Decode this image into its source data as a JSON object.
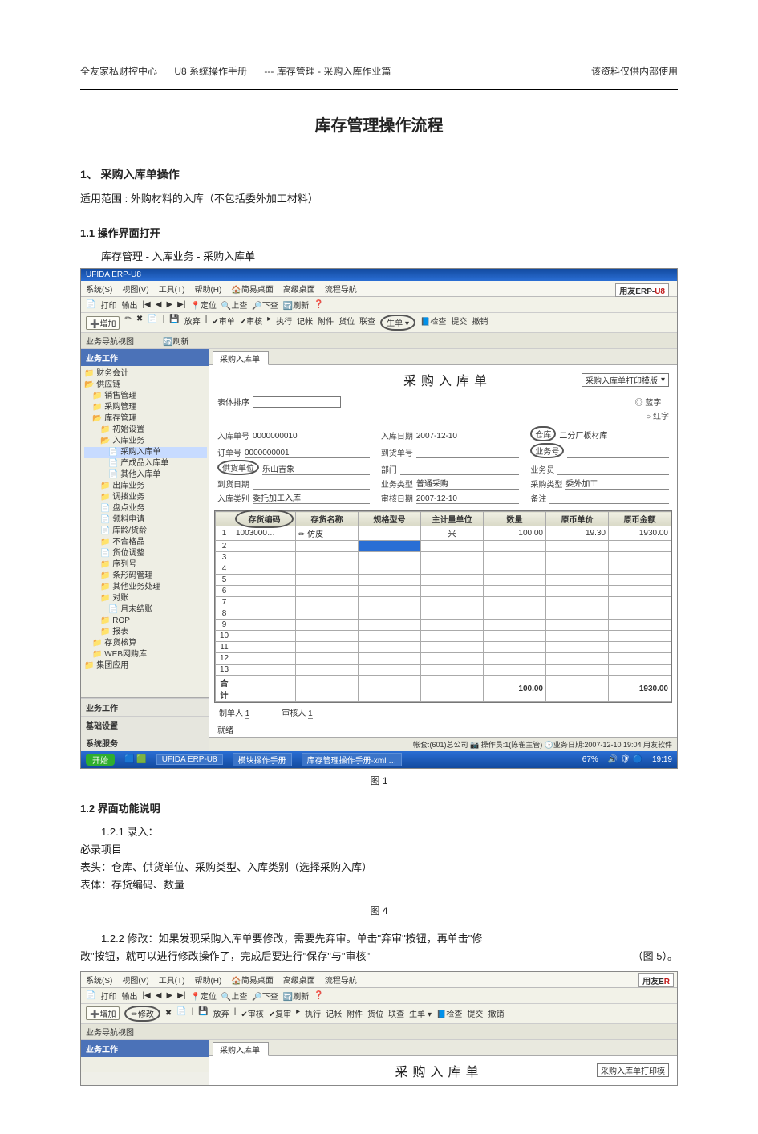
{
  "header": {
    "org": "全友家私财控中心",
    "manual": "U8  系统操作手册",
    "crumb": "--- 库存管理  - 采购入库作业篇",
    "note": "该资料仅供内部使用"
  },
  "doc": {
    "title": "库存管理操作流程",
    "s1": "1、 采购入库单操作",
    "s1_scope_label": "适用范围    :",
    "s1_scope": "外购材料的入库（不包括委外加工材料）",
    "s1_1": "1.1 操作界面打开",
    "s1_1_path": "库存管理 - 入库业务 - 采购入库单",
    "fig1": "图  1",
    "s1_2": "1.2  界面功能说明",
    "s1_2_1": "1.2.1 录入：",
    "must": "必录项目",
    "must_head": "表头：仓库、供货单位、采购类型、入库类别（选择采购入库）",
    "must_body": "表体：存货编码、数量",
    "fig4": "图  4",
    "s1_2_2a": "1.2.2 修改：如果发现采购入库单要修改，需要先弃审。单击\"弃审\"按钮，再单击\"修",
    "s1_2_2b": "改\"按钮，就可以进行修改操作了，完成后要进行\"保存\"与\"审核\"",
    "s1_2_2c": "（图  5）。"
  },
  "shot": {
    "titlebar": "UFIDA ERP-U8",
    "menu": [
      "系统(S)",
      "视图(V)",
      "工具(T)",
      "帮助(H)",
      "🏠简易桌面",
      "高级桌面",
      "流程导航"
    ],
    "brand_a": "用友ERP-",
    "brand_b": "U8",
    "tool1": [
      "📄",
      "打印",
      "输出",
      "|◀",
      "◀",
      "▶",
      "▶|",
      "📍定位",
      "🔍上查",
      "🔎下查",
      "🔄刷新",
      "❓"
    ],
    "tool2_add": "➕增加",
    "tool2": [
      "✏",
      "✖",
      "📄",
      "|",
      "💾",
      "放弃",
      "|",
      "✔审单",
      "✔审核",
      "▸",
      "执行",
      "记帐",
      "附件",
      "货位",
      "联查",
      "生单 ▾",
      "📘检查",
      "提交",
      "撤销"
    ],
    "circle_btn": "生单",
    "nav_hdr": "业务导航视图",
    "nav_refresh": "🔄刷新",
    "nav_title": "业务工作",
    "tree": [
      {
        "t": "财务会计",
        "l": 0,
        "i": "📁"
      },
      {
        "t": "供应链",
        "l": 0,
        "i": "📂"
      },
      {
        "t": "销售管理",
        "l": 1,
        "i": "📁"
      },
      {
        "t": "采购管理",
        "l": 1,
        "i": "📁"
      },
      {
        "t": "库存管理",
        "l": 1,
        "i": "📂"
      },
      {
        "t": "初始设置",
        "l": 2,
        "i": "📁"
      },
      {
        "t": "入库业务",
        "l": 2,
        "i": "📂"
      },
      {
        "t": "采购入库单",
        "l": 3,
        "i": "📄",
        "sel": true
      },
      {
        "t": "产成品入库单",
        "l": 3,
        "i": "📄"
      },
      {
        "t": "其他入库单",
        "l": 3,
        "i": "📄"
      },
      {
        "t": "出库业务",
        "l": 2,
        "i": "📁"
      },
      {
        "t": "调拨业务",
        "l": 2,
        "i": "📁"
      },
      {
        "t": "盘点业务",
        "l": 2,
        "i": "📄"
      },
      {
        "t": "领料申请",
        "l": 2,
        "i": "📄"
      },
      {
        "t": "库龄/货龄",
        "l": 2,
        "i": "📄"
      },
      {
        "t": "不合格品",
        "l": 2,
        "i": "📁"
      },
      {
        "t": "货位调整",
        "l": 2,
        "i": "📄"
      },
      {
        "t": "序列号",
        "l": 2,
        "i": "📁"
      },
      {
        "t": "条形码管理",
        "l": 2,
        "i": "📁"
      },
      {
        "t": "其他业务处理",
        "l": 2,
        "i": "📁"
      },
      {
        "t": "对账",
        "l": 2,
        "i": "📁"
      },
      {
        "t": "月末结账",
        "l": 3,
        "i": "📄"
      },
      {
        "t": "ROP",
        "l": 2,
        "i": "📁"
      },
      {
        "t": "报表",
        "l": 2,
        "i": "📁"
      },
      {
        "t": "存货核算",
        "l": 1,
        "i": "📁"
      },
      {
        "t": "WEB网购库",
        "l": 1,
        "i": "📁"
      },
      {
        "t": "集团应用",
        "l": 0,
        "i": "📁"
      }
    ],
    "nav_foot": [
      "业务工作",
      "基础设置",
      "系统服务"
    ],
    "tab": "采购入库单",
    "form_title": "采购入库单",
    "print_tpl": "采购入库单打印模版",
    "sort_lbl": "表体排序",
    "flags": [
      "◎ 蓝字",
      "○ 红字"
    ],
    "fields": {
      "rkdh_l": "入库单号",
      "rkdh_v": "0000000010",
      "rkrq_l": "入库日期",
      "rkrq_v": "2007-12-10",
      "ck_l": "仓库",
      "ck_v": "二分厂板材库",
      "ddh_l": "订单号",
      "ddh_v": "0000000001",
      "dhdh_l": "到货单号",
      "dhdh_v": "",
      "ywh_l": "业务号",
      "ywh_v": "",
      "ghdw_l": "供货单位",
      "ghdw_v": "乐山吉象",
      "bm_l": "部门",
      "bm_v": "",
      "ywy_l": "业务员",
      "ywy_v": "",
      "dhrq_l": "到货日期",
      "dhrq_v": "",
      "ywlx_l": "业务类型",
      "ywlx_v": "普通采购",
      "cglx_l": "采购类型",
      "cglx_v": "委外加工",
      "rklb_l": "入库类别",
      "rklb_v": "委托加工入库",
      "shrq_l": "审核日期",
      "shrq_v": "2007-12-10",
      "bz_l": "备注",
      "bz_v": ""
    },
    "grid_cols": [
      "存货编码",
      "存货名称",
      "规格型号",
      "主计量单位",
      "数量",
      "原币单价",
      "原币金额"
    ],
    "grid_row": {
      "code": "1003000…",
      "name": "✏  仿皮",
      "spec": "",
      "unit": "米",
      "qty": "100.00",
      "price": "19.30",
      "amt": "1930.00"
    },
    "grid_total_lbl": "合计",
    "grid_total_qty": "100.00",
    "grid_total_amt": "1930.00",
    "maker_l": "制单人",
    "maker_v": "1",
    "auditor_l": "审核人",
    "auditor_v": "1",
    "status": "帐套:(601)总公司 📷 操作员:1(陈雀主管) 🕒业务日期:2007-12-10 19:04  用友软件",
    "tb_start": "开始",
    "tb_items": [
      "UFIDA ERP-U8",
      "模块操作手册",
      "库存管理操作手册-xml …"
    ],
    "tb_time": "19:19",
    "tb_pct": "67%"
  },
  "shot2": {
    "menu": [
      "系统(S)",
      "视图(V)",
      "工具(T)",
      "帮助(H)",
      "🏠简易桌面",
      "高级桌面",
      "流程导航"
    ],
    "brand_a": "用友E",
    "brand_b": "R",
    "tool1": [
      "📄",
      "打印",
      "输出",
      "|◀",
      "◀",
      "▶",
      "▶|",
      "📍定位",
      "🔍上查",
      "🔎下查",
      "🔄刷新",
      "❓"
    ],
    "tool2_add": "➕增加",
    "tool2_mod": "✏修改",
    "tool2_del": "✖",
    "tool2_rest": [
      "📄",
      "|",
      "💾",
      "放弃",
      "|",
      "✔审核",
      "✔复审",
      "▸",
      "执行",
      "记帐",
      "附件",
      "货位",
      "联查",
      "生单 ▾",
      "📘检查",
      "提交",
      "撤销"
    ],
    "nav_hdr": "业务导航视图",
    "nav_title": "业务工作",
    "tab": "采购入库单",
    "form_title": "采购入库单",
    "print_tpl": "采购入库单打印模"
  }
}
